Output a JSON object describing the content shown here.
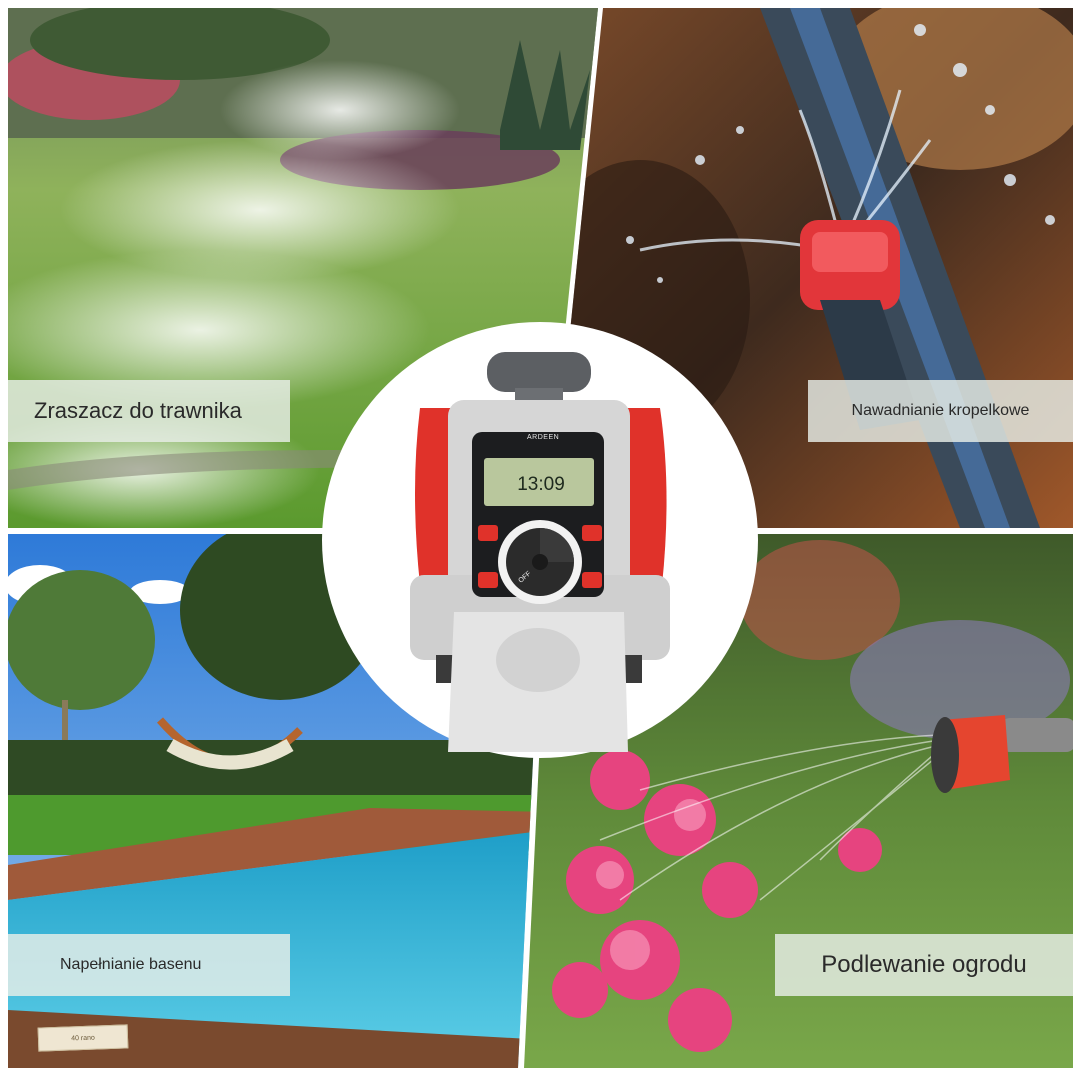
{
  "labels": {
    "lawn": "Zraszacz do trawnika",
    "drip": "Nawadnianie kropelkowe",
    "pool": "Napełnianie basenu",
    "garden": "Podlewanie ogrodu"
  },
  "device": {
    "brand": "ARDEEN",
    "time": "13:09",
    "dial_off": "OFF"
  },
  "pool_tag": "40 rano",
  "colors": {
    "device_red": "#d9332b",
    "device_grey": "#c9c9c9",
    "lcd": "#b9c79d",
    "grass": "#6aa33c",
    "pool_water": "#2fb3d4",
    "sky": "#3d8fe0",
    "flowers_pink": "#e6447f"
  }
}
